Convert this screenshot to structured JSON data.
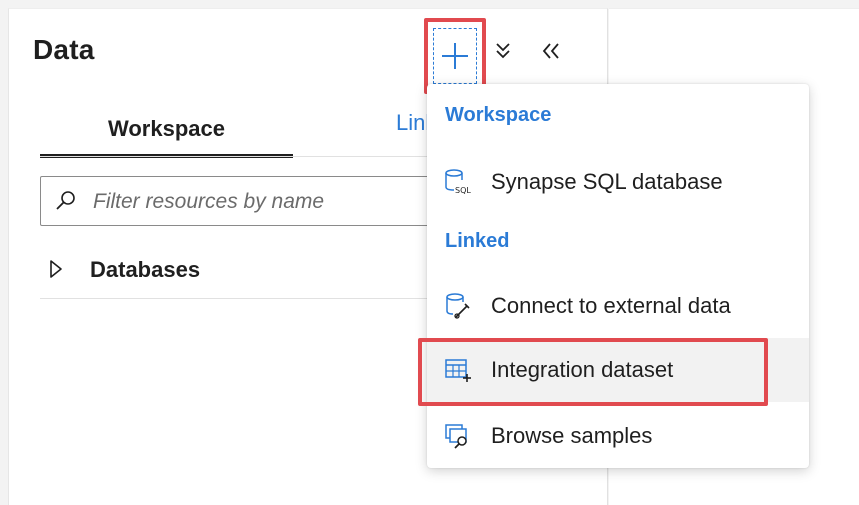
{
  "panel": {
    "title": "Data",
    "tabs": [
      {
        "label": "Workspace",
        "active": true
      },
      {
        "label": "Linked",
        "active": false
      }
    ],
    "search": {
      "placeholder": "Filter resources by name",
      "value": ""
    },
    "tree": [
      {
        "label": "Databases",
        "expanded": false
      }
    ]
  },
  "toolbar": {
    "add_icon": "plus-icon",
    "collapse_icon": "collapse-all-icon",
    "hide_icon": "double-chevron-left-icon"
  },
  "menu": {
    "sections": [
      {
        "heading": "Workspace",
        "items": [
          {
            "label": "Synapse SQL database",
            "icon": "sql-database-icon"
          }
        ]
      },
      {
        "heading": "Linked",
        "items": [
          {
            "label": "Connect to external data",
            "icon": "external-data-icon"
          },
          {
            "label": "Integration dataset",
            "icon": "integration-dataset-icon",
            "highlighted": true
          },
          {
            "label": "Browse samples",
            "icon": "browse-samples-icon"
          }
        ]
      }
    ]
  },
  "colors": {
    "accent": "#2b7bd6",
    "highlight_border": "#e14a4f",
    "text": "#1f1f1f",
    "hover_bg": "#f2f2f2"
  }
}
